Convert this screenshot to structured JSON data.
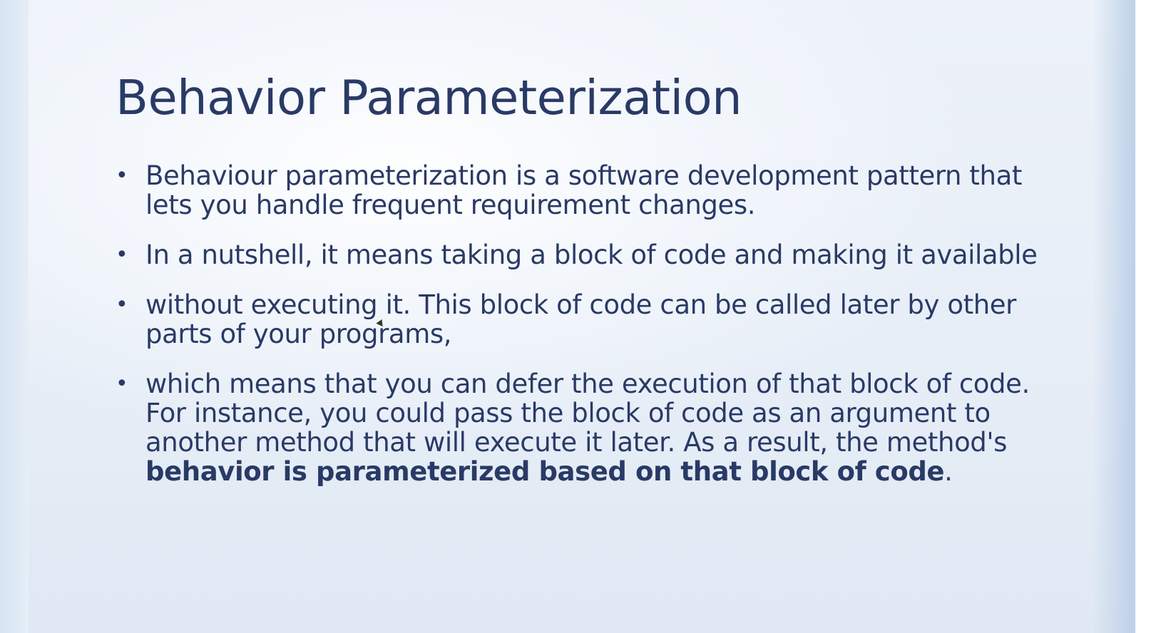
{
  "slide": {
    "title": "Behavior Parameterization",
    "bullets": [
      {
        "text": "Behaviour parameterization is a software development pattern that lets you handle frequent requirement changes."
      },
      {
        "text": "In a nutshell, it means taking a block of code and making it available"
      },
      {
        "text": "without executing it. This block of code can be called later by other parts of your programs,"
      },
      {
        "text_plain": "which means that you can defer the execution of that block of code. For instance, you could pass the block of code as an argument to another method that will execute it later. As a result, the method's ",
        "text_bold": "behavior is parameterized based on that block of code",
        "text_end": "."
      }
    ],
    "bullet_glyph": "•"
  },
  "colors": {
    "text": "#2a3a66",
    "background_light": "#edf2f9",
    "background_edge": "#bcd0e7"
  }
}
